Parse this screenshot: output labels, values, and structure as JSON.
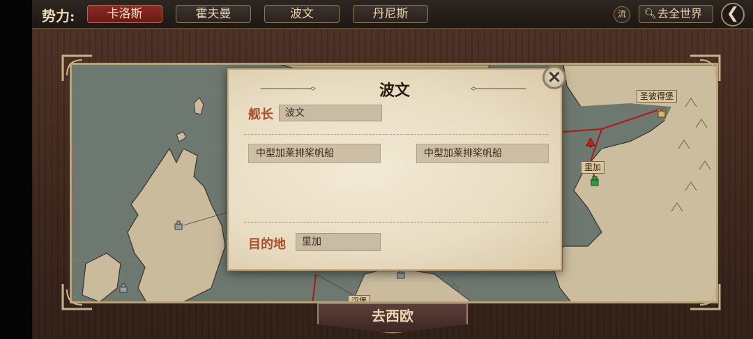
{
  "topbar": {
    "faction_label": "势力:",
    "tabs": [
      {
        "label": "卡洛斯",
        "active": true
      },
      {
        "label": "霍夫曼",
        "active": false
      },
      {
        "label": "波文",
        "active": false
      },
      {
        "label": "丹尼斯",
        "active": false
      }
    ],
    "flow_label": "流",
    "world_button": "去全世界",
    "back_icon": "back-arrow-icon"
  },
  "map": {
    "labels": {
      "st_petersburg": "圣彼得堡",
      "riga": "里加",
      "bottom_partial": "汉堡"
    }
  },
  "dialog": {
    "title": "波文",
    "captain_label": "舰长",
    "captain_value": "波文",
    "ships": [
      "中型加莱排桨帆船",
      "中型加莱排桨帆船"
    ],
    "destination_label": "目的地",
    "destination_value": "里加",
    "close_icon": "close-icon"
  },
  "go_button": "去西欧",
  "colors": {
    "active_tab": "#8c2a22",
    "label_accent": "#a84d27",
    "route_line": "#b01818"
  }
}
